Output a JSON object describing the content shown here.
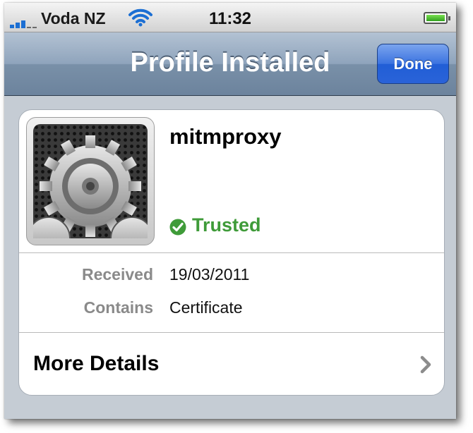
{
  "status_bar": {
    "carrier": "Voda NZ",
    "time": "11:32",
    "signal_icon": "signal-bars-icon",
    "wifi_icon": "wifi-icon",
    "battery_icon": "battery-icon",
    "battery_level": 1.0
  },
  "nav_bar": {
    "title": "Profile Installed",
    "done_label": "Done"
  },
  "profile": {
    "name": "mitmproxy",
    "icon": "settings-gears-icon",
    "status": "Trusted",
    "status_icon": "checkmark-icon",
    "details": [
      {
        "label": "Received",
        "value": "19/03/2011"
      },
      {
        "label": "Contains",
        "value": "Certificate"
      }
    ],
    "more_label": "More Details",
    "more_icon": "chevron-right-icon"
  },
  "colors": {
    "done_button": "#215ed6",
    "trusted_green": "#3f9b39",
    "wifi_blue": "#1c6fd3"
  }
}
